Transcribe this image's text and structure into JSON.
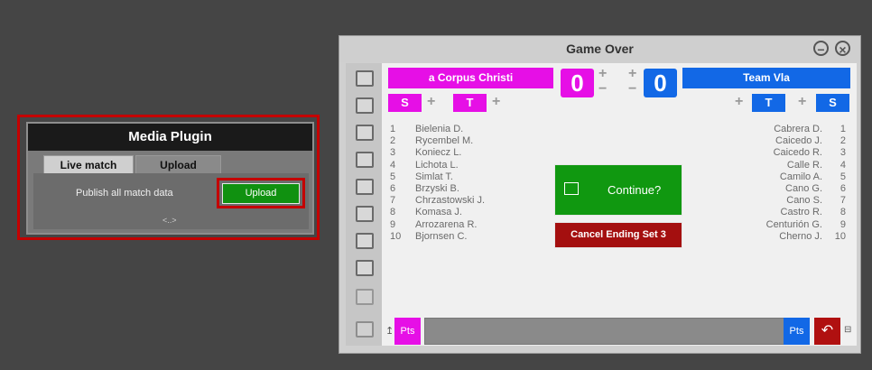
{
  "media_plugin": {
    "title": "Media Plugin",
    "tabs": [
      {
        "label": "Live match"
      },
      {
        "label": "Upload"
      }
    ],
    "description": "Publish all match data",
    "upload_button": "Upload",
    "footer": "<..>"
  },
  "game_window": {
    "title": "Game Over",
    "home": {
      "name": "a Corpus Christi",
      "score": "0",
      "s_label": "S",
      "t_label": "T",
      "players": [
        {
          "num": "1",
          "name": "Bielenia D."
        },
        {
          "num": "2",
          "name": "Rycembel M."
        },
        {
          "num": "3",
          "name": "Koniecz L."
        },
        {
          "num": "4",
          "name": "Lichota L."
        },
        {
          "num": "5",
          "name": "Simlat T."
        },
        {
          "num": "6",
          "name": "Brzyski B."
        },
        {
          "num": "7",
          "name": "Chrzastowski J."
        },
        {
          "num": "8",
          "name": "Komasa J."
        },
        {
          "num": "9",
          "name": "Arrozarena R."
        },
        {
          "num": "10",
          "name": "Bjornsen C."
        }
      ]
    },
    "away": {
      "name": "Team Vla",
      "score": "0",
      "s_label": "S",
      "t_label": "T",
      "players": [
        {
          "num": "1",
          "name": "Cabrera D."
        },
        {
          "num": "2",
          "name": "Caicedo J."
        },
        {
          "num": "3",
          "name": "Caicedo R."
        },
        {
          "num": "4",
          "name": "Calle R."
        },
        {
          "num": "5",
          "name": "Camilo A."
        },
        {
          "num": "6",
          "name": "Cano G."
        },
        {
          "num": "7",
          "name": "Cano S."
        },
        {
          "num": "8",
          "name": "Castro R."
        },
        {
          "num": "9",
          "name": "Centurión G."
        },
        {
          "num": "10",
          "name": "Cherno J."
        }
      ]
    },
    "continue_label": "Continue?",
    "cancel_label": "Cancel Ending Set 3",
    "pts_left": "Pts",
    "pts_right": "Pts"
  },
  "colors": {
    "home": "#e60fe6",
    "away": "#1268e6",
    "continue": "#109810",
    "cancel": "#a40f0f",
    "annotation": "#d40000"
  }
}
